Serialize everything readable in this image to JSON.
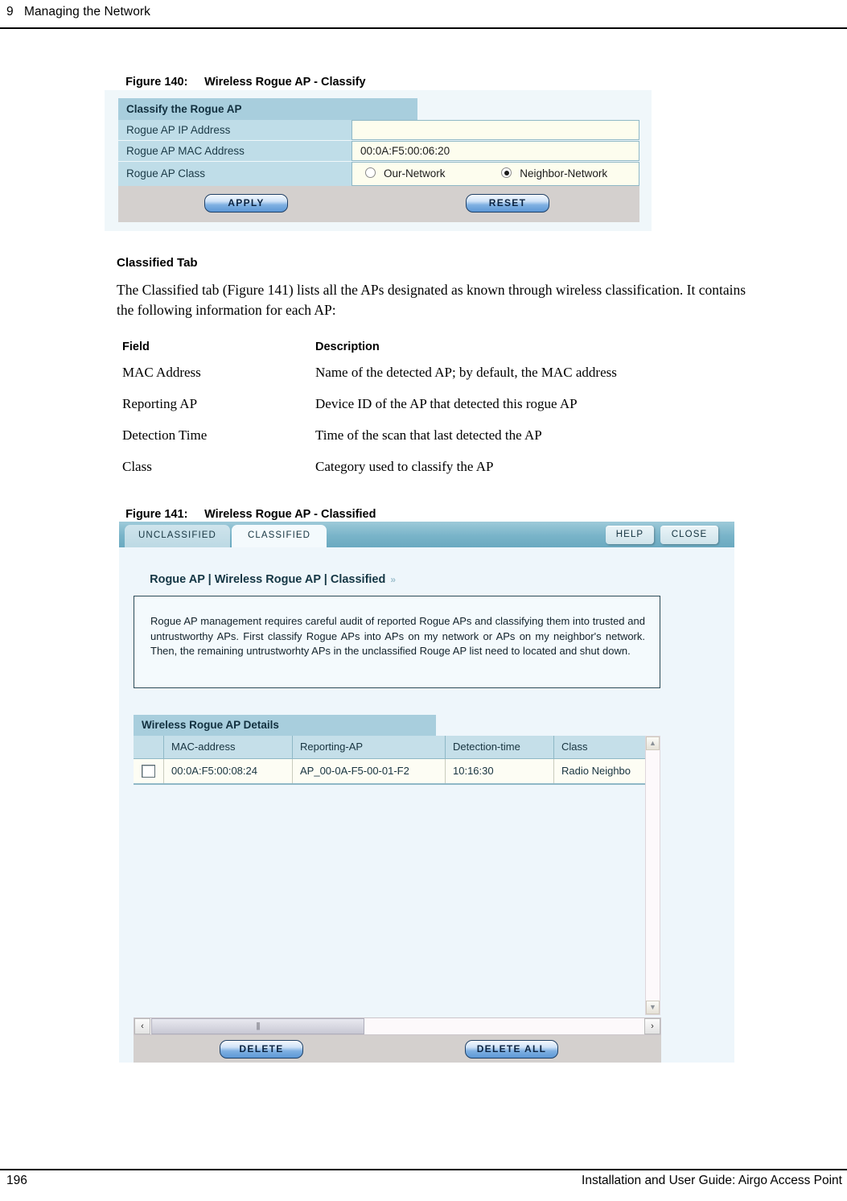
{
  "page": {
    "chapter_header": "9   Managing the Network",
    "page_number": "196",
    "footer_right": "Installation and User Guide: Airgo Access Point"
  },
  "figure140": {
    "caption_number": "Figure 140:",
    "caption_title": "Wireless Rogue AP - Classify",
    "panel_title": "Classify the Rogue AP",
    "rows": [
      {
        "label": "Rogue AP IP Address",
        "value": ""
      },
      {
        "label": "Rogue AP MAC Address",
        "value": "00:0A:F5:00:06:20"
      }
    ],
    "class_row_label": "Rogue AP Class",
    "radio_our_label": "Our-Network",
    "radio_neighbor_label": "Neighbor-Network",
    "selected_class": "Neighbor-Network",
    "apply_label": "APPLY",
    "reset_label": "RESET"
  },
  "classified_section": {
    "heading": "Classified Tab",
    "paragraph": "The Classified tab (Figure 141) lists all the APs designated as known through wireless classification. It contains the following information for each AP:",
    "table": {
      "headers": [
        "Field",
        "Description"
      ],
      "rows": [
        [
          "MAC Address",
          "Name of the detected AP; by default, the MAC address"
        ],
        [
          "Reporting AP",
          "Device ID of the AP that detected this rogue AP"
        ],
        [
          "Detection Time",
          "Time of the scan that last detected the AP"
        ],
        [
          "Class",
          "Category used to classify the AP"
        ]
      ]
    }
  },
  "figure141": {
    "caption_number": "Figure 141:",
    "caption_title": "Wireless Rogue AP - Classified",
    "tabs": [
      {
        "label": "UNCLASSIFIED",
        "active": false
      },
      {
        "label": "CLASSIFIED",
        "active": true
      }
    ],
    "help_label": "HELP",
    "close_label": "CLOSE",
    "breadcrumb": "Rogue AP | Wireless Rogue AP | Classified",
    "breadcrumb_chevron": "»",
    "note_text": "Rogue AP management requires careful audit of reported Rogue APs and classifying them into trusted and untrustworthy APs. First classify Rogue APs into APs on my network or APs on my neighbor's network. Then, the remaining untrustworhty APs in the unclassified Rouge AP list need to located and shut down.",
    "details_title": "Wireless Rogue AP Details",
    "grid": {
      "headers": [
        "",
        "MAC-address",
        "Reporting-AP",
        "Detection-time",
        "Class"
      ],
      "rows": [
        {
          "checked": false,
          "mac": "00:0A:F5:00:08:24",
          "reporting_ap": "AP_00-0A-F5-00-01-F2",
          "detection_time": "10:16:30",
          "class": "Radio Neighbo"
        }
      ]
    },
    "scroll_up_glyph": "▲",
    "scroll_down_glyph": "▼",
    "scroll_left_glyph": "‹",
    "scroll_right_glyph": "›",
    "scroll_thumb_grip": "||||",
    "delete_label": "DELETE",
    "delete_all_label": "DELETE ALL"
  }
}
